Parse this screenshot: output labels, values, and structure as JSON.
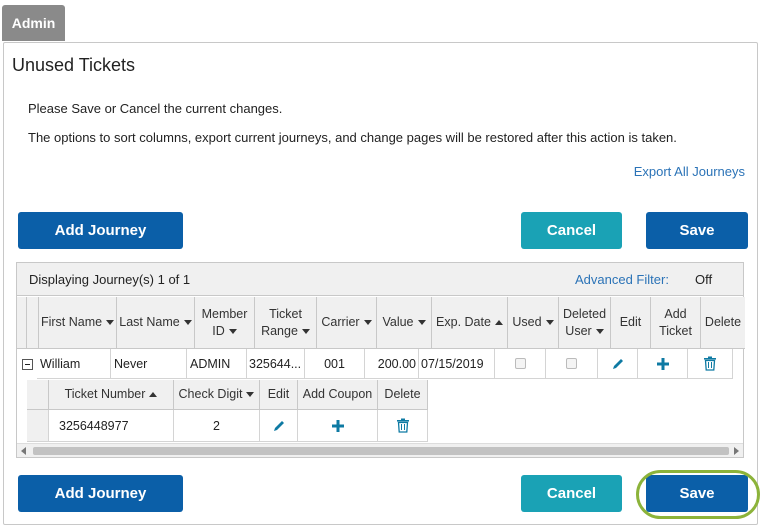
{
  "tab": {
    "label": "Admin"
  },
  "panel": {
    "title": "Unused Tickets"
  },
  "messages": {
    "line1": "Please Save or Cancel the current changes.",
    "line2": "The options to sort columns, export current journeys, and change pages will be restored after this action is taken."
  },
  "export_link": "Export All Journeys",
  "buttons": {
    "add_journey": "Add Journey",
    "cancel": "Cancel",
    "save": "Save"
  },
  "grid": {
    "displaying": "Displaying Journey(s) 1 of 1",
    "advanced_filter_label": "Advanced Filter:",
    "advanced_filter_value": "Off",
    "columns": {
      "first_name": "First Name",
      "last_name": "Last Name",
      "member_id_1": "Member",
      "member_id_2": "ID",
      "ticket_range_1": "Ticket",
      "ticket_range_2": "Range",
      "carrier": "Carrier",
      "value": "Value",
      "exp_date": "Exp. Date",
      "used": "Used",
      "deleted_user_1": "Deleted",
      "deleted_user_2": "User",
      "edit": "Edit",
      "add_ticket_1": "Add",
      "add_ticket_2": "Ticket",
      "delete": "Delete"
    },
    "row": {
      "first_name": "William",
      "last_name": "Never",
      "member_id": "ADMIN",
      "ticket_range": "325644...",
      "carrier": "001",
      "value": "200.00",
      "exp_date": "07/15/2019",
      "used": false,
      "deleted_user": false
    },
    "sub_columns": {
      "ticket_number": "Ticket Number",
      "check_digit": "Check Digit",
      "edit": "Edit",
      "add_coupon": "Add Coupon",
      "delete": "Delete"
    },
    "sub_row": {
      "ticket_number": "3256448977",
      "check_digit": "2"
    }
  },
  "colors": {
    "primary": "#0b5fa8",
    "cancel": "#1aa2b5",
    "link": "#2b73b7",
    "icon": "#0e7aa3",
    "highlight": "#8cb33a"
  },
  "icons": [
    "pencil-icon",
    "plus-icon",
    "trash-icon"
  ]
}
